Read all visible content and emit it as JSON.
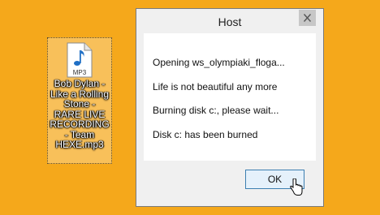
{
  "desktop": {
    "icon": {
      "type_label": "MP3",
      "glyph": "music-note-icon",
      "filename": "Bob Dylan - Like a Rolling Stone - RARE LIVE RECORDING - Team HEXE.mp3"
    }
  },
  "dialog": {
    "title": "Host",
    "close_glyph": "close-icon",
    "messages": [
      "Opening ws_olympiaki_floga...",
      "Life is not beautiful any more",
      "Burning disk c:, please wait...",
      "Disk c: has been burned"
    ],
    "ok_label": "OK"
  },
  "colors": {
    "desktop_background": "#f5a81b",
    "dialog_background": "#f0f0f0",
    "content_background": "#ffffff",
    "close_hover": "#c7c7c7",
    "ok_border": "#3c7fb1",
    "ok_background": "#e5f1fb",
    "mp3_blue": "#1f6fc5"
  }
}
